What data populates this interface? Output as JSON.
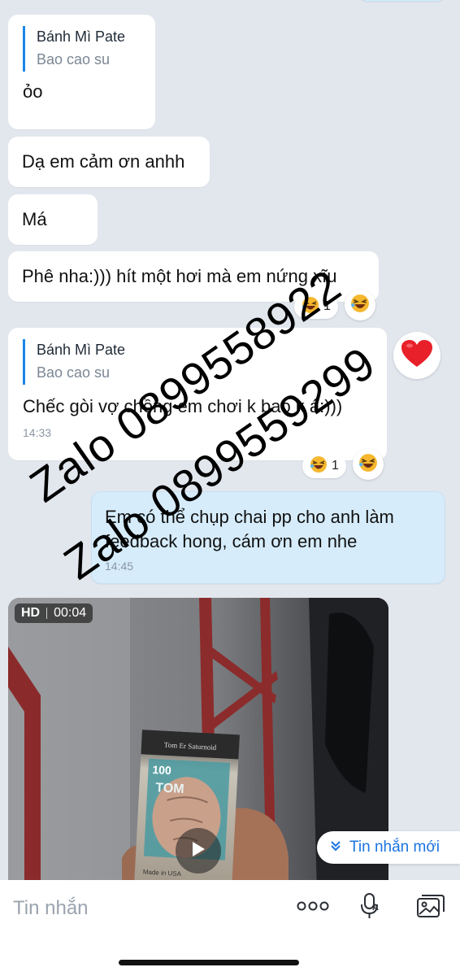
{
  "messages": [
    {
      "quote_name": "Bánh Mì Pate",
      "quote_text": "Bao cao su",
      "text": "ỏo"
    },
    {
      "text": "Dạ em cảm ơn anhh"
    },
    {
      "text": "Má"
    },
    {
      "text": "Phê nha:))) hít một hơi mà em nứng xĩu",
      "reaction_count": "1"
    },
    {
      "quote_name": "Bánh Mì Pate",
      "quote_text": "Bao cao su",
      "text": "Chếc gòi vợ chồng em chơi k bao k á:)))",
      "time": "14:33",
      "reaction_count": "1"
    },
    {
      "text_line1": "Em có thể chụp chai pp cho anh làm",
      "text_line2": "feedback hong, cám ơn em nhe",
      "time": "14:45"
    }
  ],
  "video": {
    "badge_hd": "HD",
    "duration": "00:04",
    "product_label_top": "Tom Er Saturnoid",
    "product_label_number": "100",
    "product_label_mid": "TOM",
    "product_label_made": "Made in USA"
  },
  "watermark": {
    "line1": "Zalo 0899558922",
    "line2": "Zalo 0899559299"
  },
  "new_message_label": "Tin nhắn mới",
  "input": {
    "placeholder": "Tin nhắn"
  },
  "colors": {
    "background": "#e2e7ee",
    "accent": "#1a74e0",
    "own_bubble": "#d6ecfb",
    "heart": "#e8202a"
  },
  "icons": [
    "laughing-face-icon",
    "heart-icon",
    "play-icon",
    "chevron-double-down-icon",
    "more-dots-icon",
    "voice-text-icon",
    "image-icon"
  ]
}
